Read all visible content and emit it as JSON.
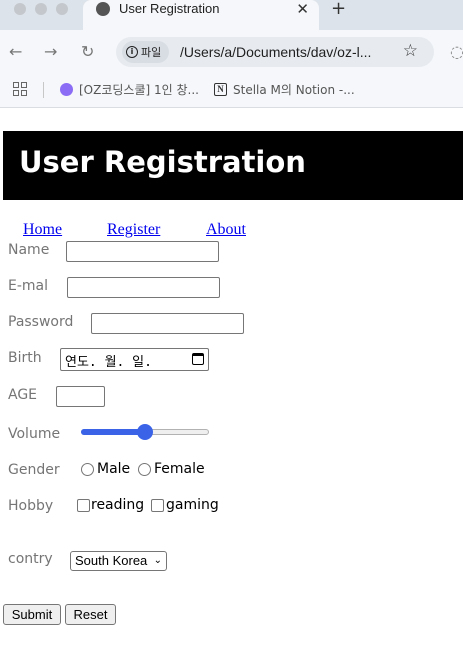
{
  "browser": {
    "tab_title": "User Registration",
    "tab_close": "✕",
    "new_tab": "+",
    "site_info_label": "파일",
    "url": "/Users/a/Documents/dav/oz-l...",
    "bookmarks": [
      {
        "label": "[OZ코딩스쿨] 1인 창..."
      },
      {
        "label": "Stella M의 Notion -..."
      }
    ],
    "icons": [
      "back-arrow-icon",
      "forward-arrow-icon",
      "reload-icon",
      "info-icon",
      "star-icon",
      "apps-icon"
    ]
  },
  "page": {
    "title": "User Registration",
    "nav": [
      "Home",
      "Register",
      "About"
    ],
    "colors": {
      "header_bg": "#000000",
      "header_text": "#ffffff",
      "link": "#0000ee",
      "accent": "#3a63e8"
    }
  },
  "form": {
    "name_label": "Name",
    "email_label": "E-mal",
    "password_label": "Password",
    "birth_label": "Birth",
    "birth_placeholder": "연도. 월. 일.",
    "age_label": "AGE",
    "volume_label": "Volume",
    "volume_level": 0.5,
    "gender_label": "Gender",
    "gender_options": [
      "Male",
      "Female"
    ],
    "hobby_label": "Hobby",
    "hobby_options": [
      "reading",
      "gaming"
    ],
    "country_label": "contry",
    "country_selected": "South Korea",
    "submit_label": "Submit",
    "reset_label": "Reset"
  }
}
